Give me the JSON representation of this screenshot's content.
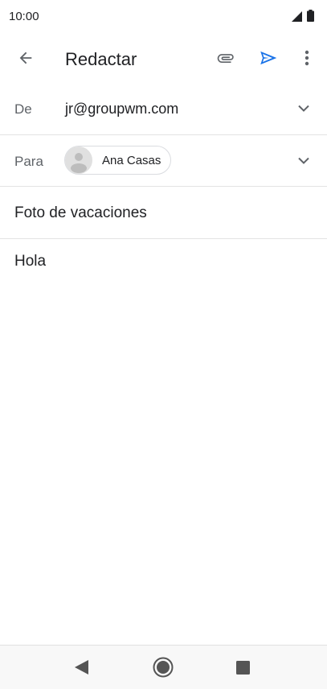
{
  "status_bar": {
    "time": "10:00"
  },
  "toolbar": {
    "title": "Redactar"
  },
  "from": {
    "label": "De",
    "value": "jr@groupwm.com"
  },
  "to": {
    "label": "Para",
    "recipient": "Ana Casas"
  },
  "subject": {
    "value": "Foto de vacaciones"
  },
  "body": {
    "value": "Hola"
  },
  "colors": {
    "send": "#1a73e8",
    "icon": "#5f6368",
    "divider": "#e3e3e3"
  },
  "icons": [
    "signal-icon",
    "battery-icon",
    "back-arrow-icon",
    "attach-icon",
    "send-icon",
    "more-vert-icon",
    "chevron-down-icon",
    "avatar-placeholder-icon",
    "nav-back-icon",
    "nav-home-icon",
    "nav-recents-icon"
  ]
}
